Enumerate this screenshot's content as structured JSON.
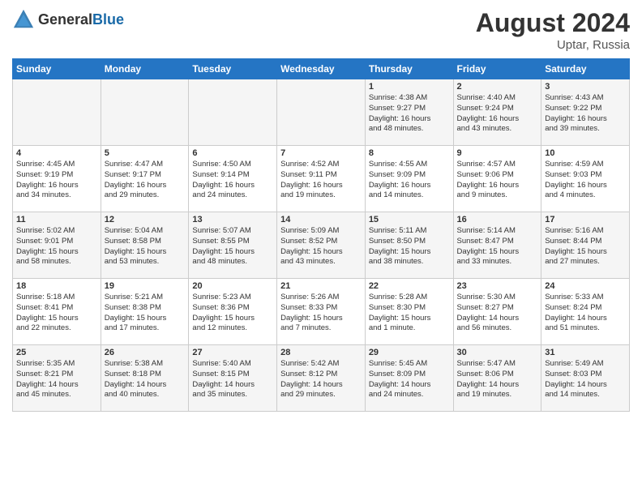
{
  "header": {
    "logo_general": "General",
    "logo_blue": "Blue",
    "month_year": "August 2024",
    "location": "Uptar, Russia"
  },
  "days_of_week": [
    "Sunday",
    "Monday",
    "Tuesday",
    "Wednesday",
    "Thursday",
    "Friday",
    "Saturday"
  ],
  "weeks": [
    [
      {
        "day": "",
        "content": ""
      },
      {
        "day": "",
        "content": ""
      },
      {
        "day": "",
        "content": ""
      },
      {
        "day": "",
        "content": ""
      },
      {
        "day": "1",
        "content": "Sunrise: 4:38 AM\nSunset: 9:27 PM\nDaylight: 16 hours\nand 48 minutes."
      },
      {
        "day": "2",
        "content": "Sunrise: 4:40 AM\nSunset: 9:24 PM\nDaylight: 16 hours\nand 43 minutes."
      },
      {
        "day": "3",
        "content": "Sunrise: 4:43 AM\nSunset: 9:22 PM\nDaylight: 16 hours\nand 39 minutes."
      }
    ],
    [
      {
        "day": "4",
        "content": "Sunrise: 4:45 AM\nSunset: 9:19 PM\nDaylight: 16 hours\nand 34 minutes."
      },
      {
        "day": "5",
        "content": "Sunrise: 4:47 AM\nSunset: 9:17 PM\nDaylight: 16 hours\nand 29 minutes."
      },
      {
        "day": "6",
        "content": "Sunrise: 4:50 AM\nSunset: 9:14 PM\nDaylight: 16 hours\nand 24 minutes."
      },
      {
        "day": "7",
        "content": "Sunrise: 4:52 AM\nSunset: 9:11 PM\nDaylight: 16 hours\nand 19 minutes."
      },
      {
        "day": "8",
        "content": "Sunrise: 4:55 AM\nSunset: 9:09 PM\nDaylight: 16 hours\nand 14 minutes."
      },
      {
        "day": "9",
        "content": "Sunrise: 4:57 AM\nSunset: 9:06 PM\nDaylight: 16 hours\nand 9 minutes."
      },
      {
        "day": "10",
        "content": "Sunrise: 4:59 AM\nSunset: 9:03 PM\nDaylight: 16 hours\nand 4 minutes."
      }
    ],
    [
      {
        "day": "11",
        "content": "Sunrise: 5:02 AM\nSunset: 9:01 PM\nDaylight: 15 hours\nand 58 minutes."
      },
      {
        "day": "12",
        "content": "Sunrise: 5:04 AM\nSunset: 8:58 PM\nDaylight: 15 hours\nand 53 minutes."
      },
      {
        "day": "13",
        "content": "Sunrise: 5:07 AM\nSunset: 8:55 PM\nDaylight: 15 hours\nand 48 minutes."
      },
      {
        "day": "14",
        "content": "Sunrise: 5:09 AM\nSunset: 8:52 PM\nDaylight: 15 hours\nand 43 minutes."
      },
      {
        "day": "15",
        "content": "Sunrise: 5:11 AM\nSunset: 8:50 PM\nDaylight: 15 hours\nand 38 minutes."
      },
      {
        "day": "16",
        "content": "Sunrise: 5:14 AM\nSunset: 8:47 PM\nDaylight: 15 hours\nand 33 minutes."
      },
      {
        "day": "17",
        "content": "Sunrise: 5:16 AM\nSunset: 8:44 PM\nDaylight: 15 hours\nand 27 minutes."
      }
    ],
    [
      {
        "day": "18",
        "content": "Sunrise: 5:18 AM\nSunset: 8:41 PM\nDaylight: 15 hours\nand 22 minutes."
      },
      {
        "day": "19",
        "content": "Sunrise: 5:21 AM\nSunset: 8:38 PM\nDaylight: 15 hours\nand 17 minutes."
      },
      {
        "day": "20",
        "content": "Sunrise: 5:23 AM\nSunset: 8:36 PM\nDaylight: 15 hours\nand 12 minutes."
      },
      {
        "day": "21",
        "content": "Sunrise: 5:26 AM\nSunset: 8:33 PM\nDaylight: 15 hours\nand 7 minutes."
      },
      {
        "day": "22",
        "content": "Sunrise: 5:28 AM\nSunset: 8:30 PM\nDaylight: 15 hours\nand 1 minute."
      },
      {
        "day": "23",
        "content": "Sunrise: 5:30 AM\nSunset: 8:27 PM\nDaylight: 14 hours\nand 56 minutes."
      },
      {
        "day": "24",
        "content": "Sunrise: 5:33 AM\nSunset: 8:24 PM\nDaylight: 14 hours\nand 51 minutes."
      }
    ],
    [
      {
        "day": "25",
        "content": "Sunrise: 5:35 AM\nSunset: 8:21 PM\nDaylight: 14 hours\nand 45 minutes."
      },
      {
        "day": "26",
        "content": "Sunrise: 5:38 AM\nSunset: 8:18 PM\nDaylight: 14 hours\nand 40 minutes."
      },
      {
        "day": "27",
        "content": "Sunrise: 5:40 AM\nSunset: 8:15 PM\nDaylight: 14 hours\nand 35 minutes."
      },
      {
        "day": "28",
        "content": "Sunrise: 5:42 AM\nSunset: 8:12 PM\nDaylight: 14 hours\nand 29 minutes."
      },
      {
        "day": "29",
        "content": "Sunrise: 5:45 AM\nSunset: 8:09 PM\nDaylight: 14 hours\nand 24 minutes."
      },
      {
        "day": "30",
        "content": "Sunrise: 5:47 AM\nSunset: 8:06 PM\nDaylight: 14 hours\nand 19 minutes."
      },
      {
        "day": "31",
        "content": "Sunrise: 5:49 AM\nSunset: 8:03 PM\nDaylight: 14 hours\nand 14 minutes."
      }
    ]
  ]
}
